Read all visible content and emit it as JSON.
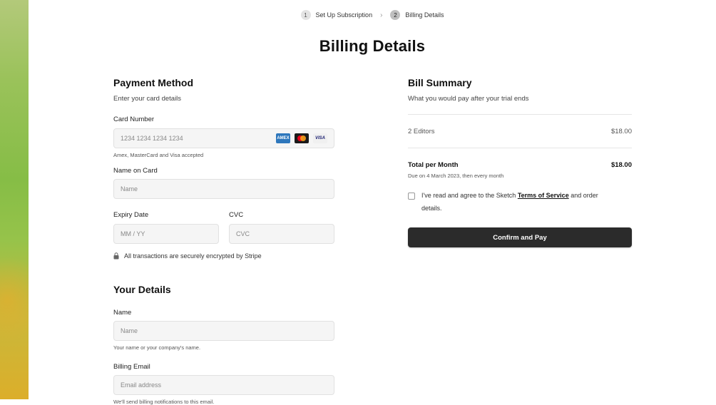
{
  "stepper": {
    "steps": [
      {
        "num": "1",
        "label": "Set Up Subscription"
      },
      {
        "num": "2",
        "label": "Billing Details"
      }
    ]
  },
  "page_title": "Billing Details",
  "payment": {
    "heading": "Payment Method",
    "subtitle": "Enter your card details",
    "card_number_label": "Card Number",
    "card_number_placeholder": "1234 1234 1234 1234",
    "cards_hint": "Amex, MasterCard and Visa accepted",
    "card_logos": {
      "amex": "AMEX",
      "visa": "VISA"
    },
    "name_label": "Name on Card",
    "name_placeholder": "Name",
    "expiry_label": "Expiry Date",
    "expiry_placeholder": "MM / YY",
    "cvc_label": "CVC",
    "cvc_placeholder": "CVC",
    "secure_note": "All transactions are securely encrypted by Stripe"
  },
  "details": {
    "heading": "Your Details",
    "name_label": "Name",
    "name_placeholder": "Name",
    "name_hint": "Your name or your company's name.",
    "email_label": "Billing Email",
    "email_placeholder": "Email address",
    "email_hint": "We'll send billing notifications to this email."
  },
  "summary": {
    "heading": "Bill Summary",
    "subtitle": "What you would pay after your trial ends",
    "line_item_label": "2 Editors",
    "line_item_value": "$18.00",
    "total_label": "Total per Month",
    "total_value": "$18.00",
    "due_note": "Due on 4 March 2023, then every month",
    "terms_prefix": "I've read and agree to the Sketch",
    "terms_link": "Terms of Service",
    "terms_suffix": "and order",
    "terms_line2": "details.",
    "confirm_label": "Confirm and Pay"
  },
  "colors": {
    "button_bg": "#2b2b2b",
    "input_bg": "#f5f5f5"
  }
}
